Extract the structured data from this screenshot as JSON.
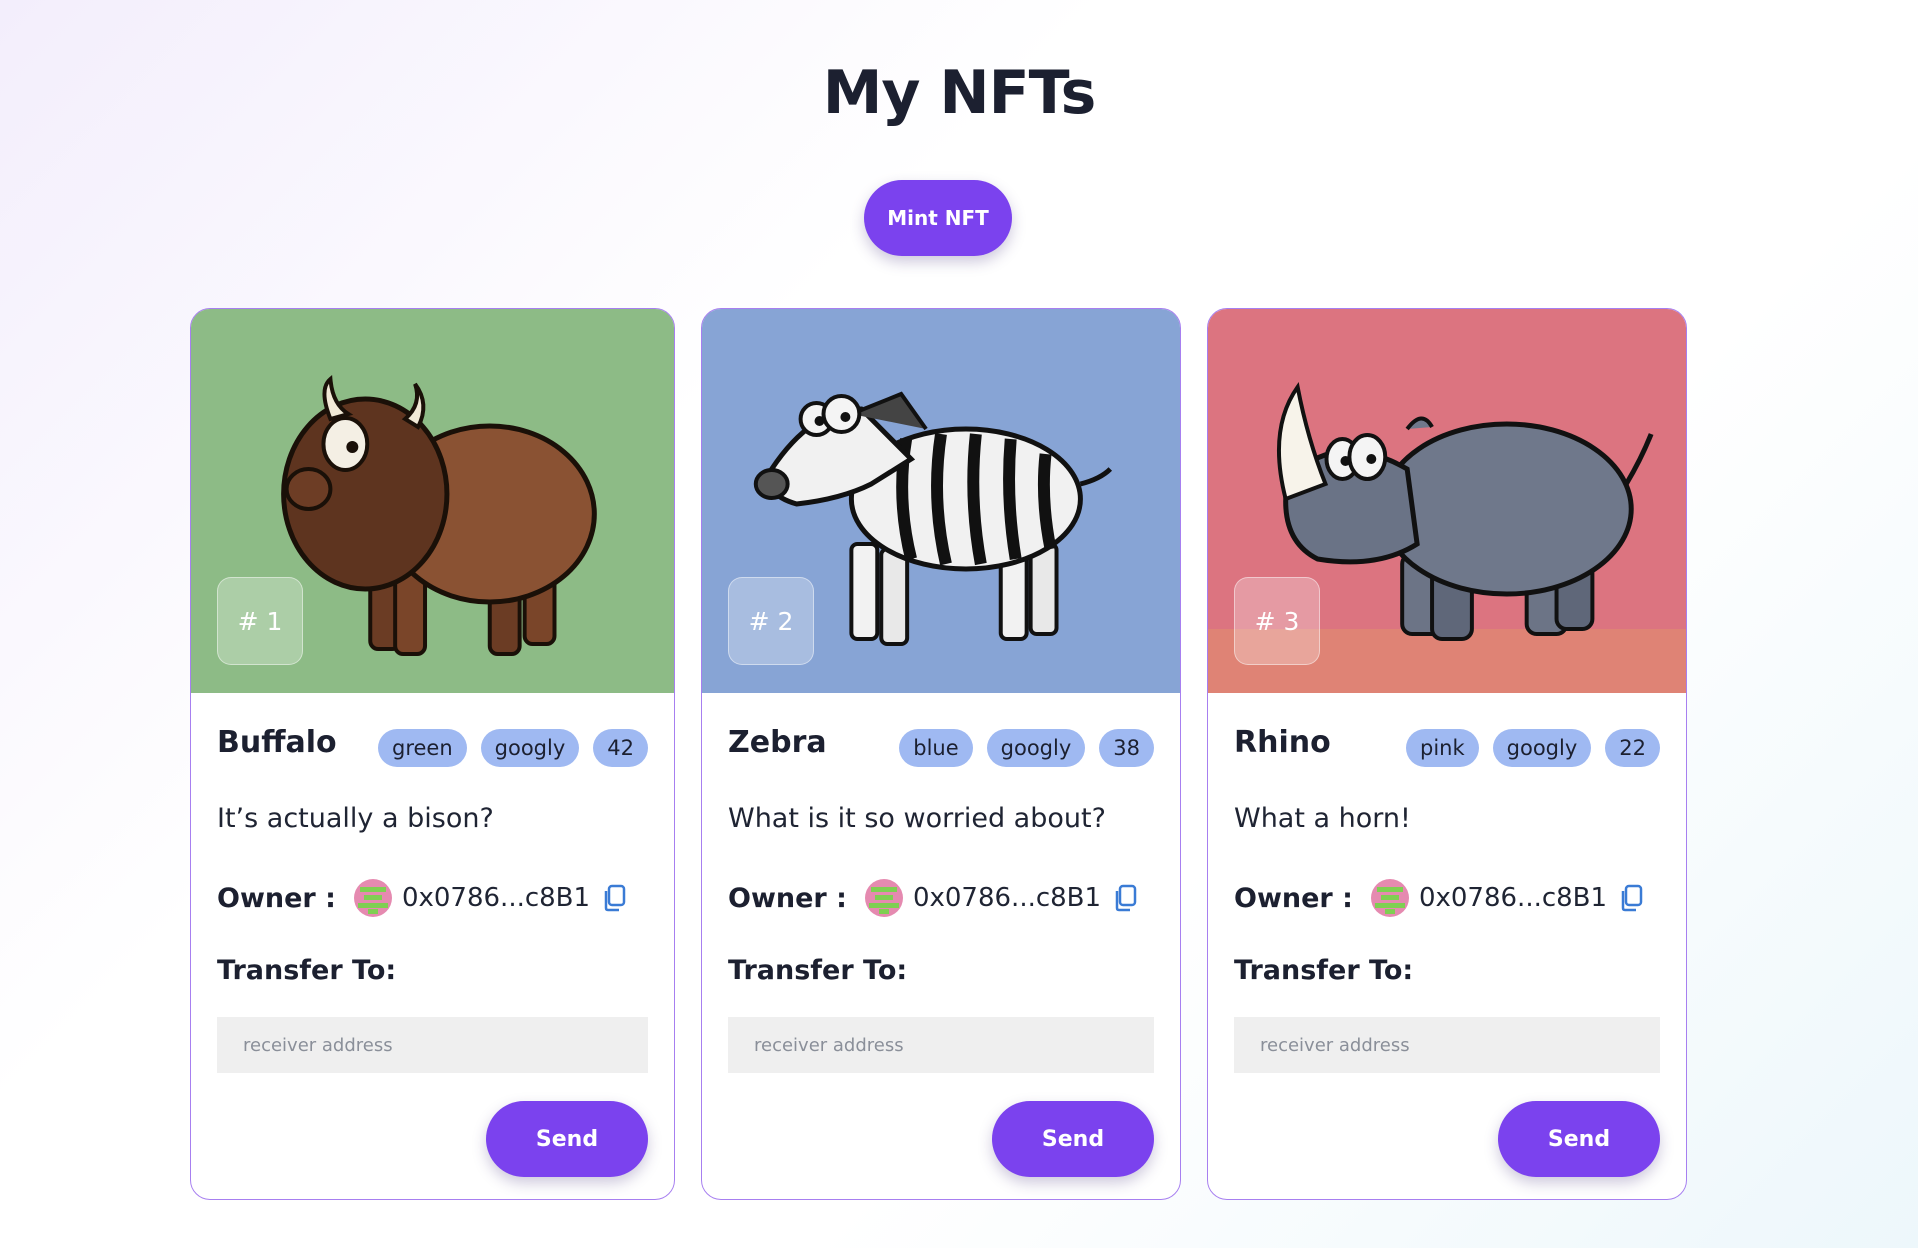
{
  "page": {
    "title": "My NFTs",
    "mint_button": "Mint NFT"
  },
  "colors": {
    "accent": "#7b42ee",
    "card_border": "#a77ff0",
    "tag_bg": "#9fb9f2"
  },
  "cards": [
    {
      "token": "# 1",
      "name": "Buffalo",
      "tags": [
        "green",
        "googly",
        "42"
      ],
      "description": "It’s actually a bison?",
      "owner_label": "Owner :",
      "owner_address": "0x0786...c8B1",
      "transfer_label": "Transfer To:",
      "input_placeholder": "receiver address",
      "send_label": "Send",
      "image_bg": "#86b57e",
      "animal": "buffalo"
    },
    {
      "token": "# 2",
      "name": "Zebra",
      "tags": [
        "blue",
        "googly",
        "38"
      ],
      "description": "What is it so worried about?",
      "owner_label": "Owner :",
      "owner_address": "0x0786...c8B1",
      "transfer_label": "Transfer To:",
      "input_placeholder": "receiver address",
      "send_label": "Send",
      "image_bg": "#7f9ed2",
      "animal": "zebra"
    },
    {
      "token": "# 3",
      "name": "Rhino",
      "tags": [
        "pink",
        "googly",
        "22"
      ],
      "description": "What a horn!",
      "owner_label": "Owner :",
      "owner_address": "0x0786...c8B1",
      "transfer_label": "Transfer To:",
      "input_placeholder": "receiver address",
      "send_label": "Send",
      "image_bg": "#dc7480",
      "animal": "rhino"
    }
  ]
}
